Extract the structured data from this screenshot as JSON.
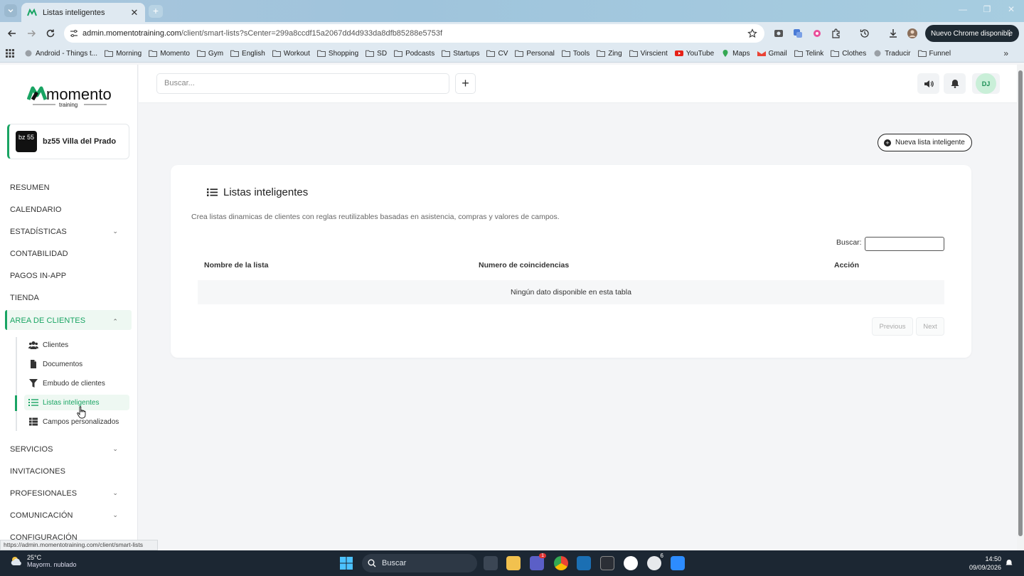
{
  "browser": {
    "tab_title": "Listas inteligentes",
    "url_host": "admin.momentotraining.com",
    "url_path": "/client/smart-lists?sCenter=299a8ccdf15a2067dd4d933da8dfb85288e5753f",
    "update_label": "Nuevo Chrome disponible",
    "bookmarks": [
      "Android - Things t...",
      "Morning",
      "Momento",
      "Gym",
      "English",
      "Workout",
      "Shopping",
      "SD",
      "Podcasts",
      "Startups",
      "CV",
      "Personal",
      "Tools",
      "Zing",
      "Virscient",
      "YouTube",
      "Maps",
      "Gmail",
      "Telink",
      "Clothes",
      "Traducir",
      "Funnel"
    ]
  },
  "brand": {
    "name": "momento",
    "sub": "training",
    "accent": "#19a463"
  },
  "org": {
    "avatar_text": "bz 55",
    "name": "bz55 Villa del Prado"
  },
  "sidebar": {
    "items": [
      "RESUMEN",
      "CALENDARIO",
      "ESTADÍSTICAS",
      "CONTABILIDAD",
      "PAGOS IN-APP",
      "TIENDA",
      "AREA DE CLIENTES"
    ],
    "sub_items": [
      "Clientes",
      "Documentos",
      "Embudo de clientes",
      "Listas inteligentes",
      "Campos personalizados"
    ],
    "items_after": [
      "SERVICIOS",
      "INVITACIONES",
      "PROFESIONALES",
      "COMUNICACIÓN",
      "CONFIGURACIÓN"
    ]
  },
  "topbar": {
    "search_placeholder": "Buscar...",
    "avatar": "DJ"
  },
  "page": {
    "new_list_label": "Nueva lista inteligente",
    "title": "Listas inteligentes",
    "description": "Crea listas dinamicas de clientes con reglas reutilizables basadas en asistencia, compras y valores de campos.",
    "search_label": "Buscar:",
    "columns": [
      "Nombre de la lista",
      "Numero de coincidencias",
      "Acción"
    ],
    "empty_text": "Ningún dato disponible en esta tabla",
    "prev_label": "Previous",
    "next_label": "Next"
  },
  "status_url": "https://admin.momentotraining.com/client/smart-lists",
  "taskbar": {
    "temp": "25°C",
    "weather": "Mayorm. nublado",
    "search": "Buscar",
    "time": "14:50",
    "date": "09/09/2026",
    "badge_teams": "1",
    "badge_chatgpt": "6"
  }
}
